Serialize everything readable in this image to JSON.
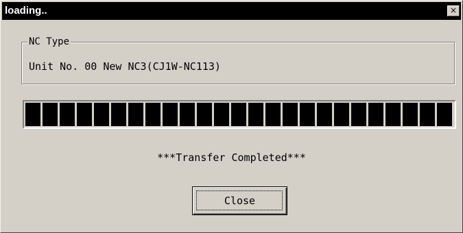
{
  "window": {
    "title": "loading..",
    "close_glyph": "×"
  },
  "group": {
    "legend": "NC Type",
    "value": "Unit No. 00 New NC3(CJ1W-NC113)"
  },
  "progress": {
    "fraction": 1.0
  },
  "status": {
    "text": "***Transfer Completed***"
  },
  "buttons": {
    "close_label": "Close"
  },
  "colors": {
    "titlebar": "#000000",
    "face": "#d4d0c8",
    "progress_block": "#000000"
  }
}
